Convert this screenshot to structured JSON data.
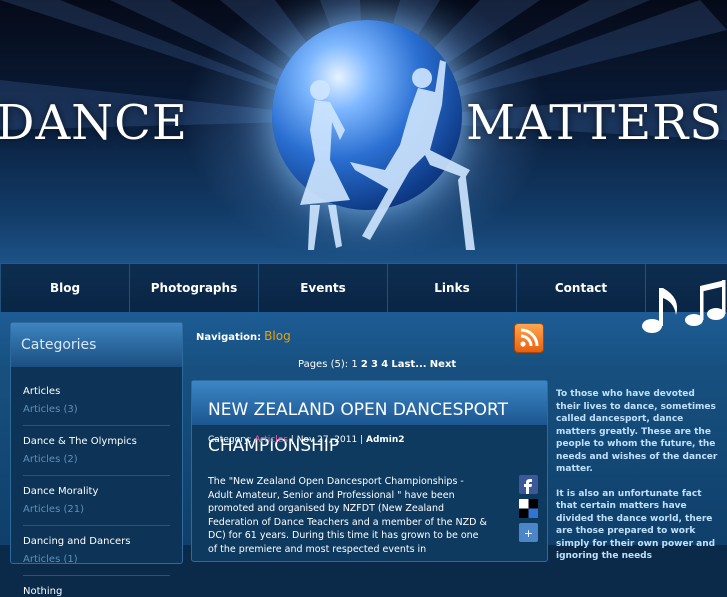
{
  "header": {
    "logo_left": "DANCE",
    "logo_right": "MATTERS"
  },
  "nav": {
    "items": [
      {
        "label": "Blog"
      },
      {
        "label": "Photographs"
      },
      {
        "label": "Events"
      },
      {
        "label": "Links"
      },
      {
        "label": "Contact"
      }
    ]
  },
  "sidebar": {
    "title": "Categories",
    "items": [
      {
        "name": "Articles",
        "count": "Articles (3)"
      },
      {
        "name": "Dance & The Olympics",
        "count": "Articles (2)"
      },
      {
        "name": "Dance Morality",
        "count": "Articles (21)"
      },
      {
        "name": "Dancing and Dancers",
        "count": "Articles (1)"
      },
      {
        "name": "Nothing",
        "count": ""
      }
    ]
  },
  "breadcrumb": {
    "label": "Navigation:",
    "current": "Blog"
  },
  "pagination": {
    "prefix": "Pages (5):",
    "p1": "1",
    "p2": "2",
    "p3": "3",
    "p4": "4",
    "last": "Last...",
    "next": "Next"
  },
  "article": {
    "title": "NEW ZEALAND OPEN DANCESPORT CHAMPIONSHIP",
    "meta_category_label": "Category:",
    "meta_category": "Articles",
    "meta_date": "Nov 27, 2011",
    "meta_author": "Admin2",
    "body": "The \"New Zealand  Open Dancesport Championships - Adult Amateur, Senior and Professional \" have been promoted and organised by NZFDT (New Zealand Federation of Dance Teachers and a member of the NZD & DC)  for 61 years. During this time it has grown to be one of the premiere and most respected events in"
  },
  "info": {
    "p1": "To those who have devoted their lives to dance, sometimes called dancesport, dance matters greatly. These are the people to whom the future, the needs and wishes of the dancer matter.",
    "p2": "It is also an unfortunate fact that certain matters have divided the dance world, there are those prepared to work simply for their own power and ignoring the needs"
  },
  "colors": {
    "accent": "#f2a000",
    "category_link": "#ff5fb0",
    "nav_bg": "#0d2d50"
  },
  "icons": {
    "rss": "rss-icon",
    "share1": "facebook-icon",
    "share2": "delicious-icon",
    "share3": "share-icon"
  }
}
